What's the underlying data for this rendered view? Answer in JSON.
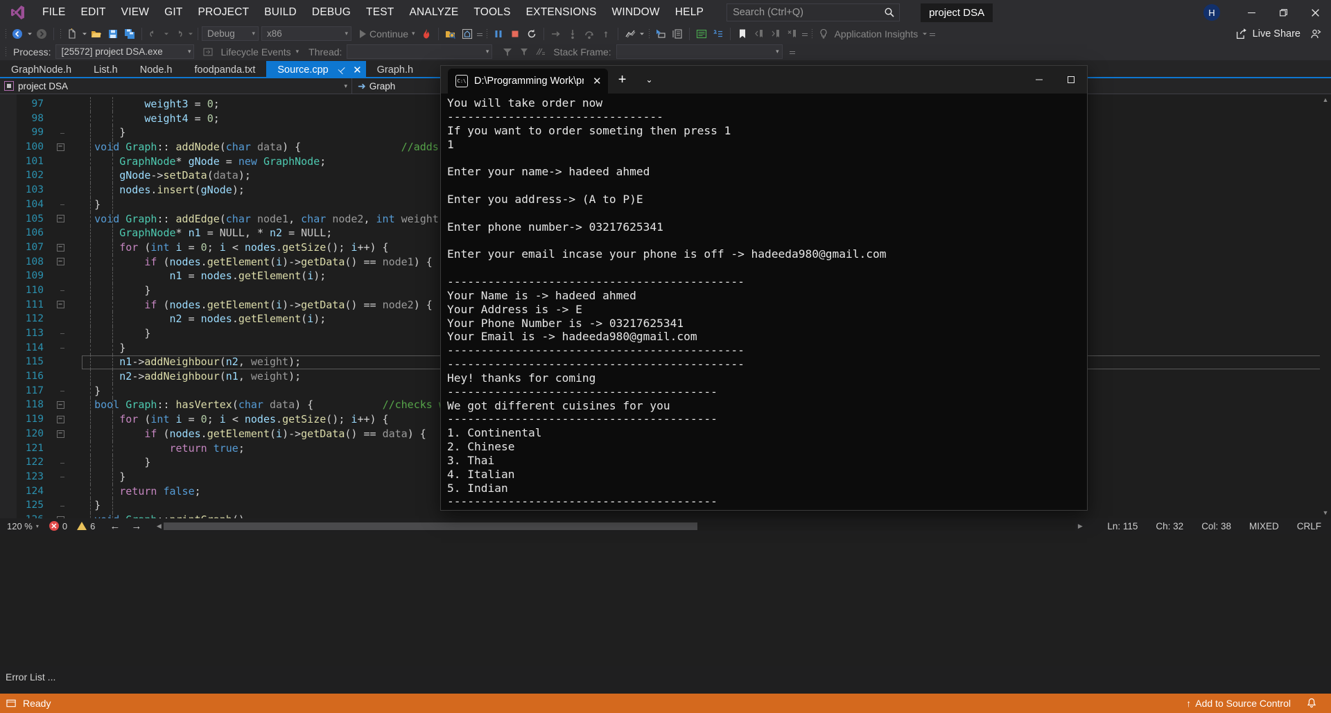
{
  "app": {
    "title_chip": "project DSA",
    "avatar_initial": "H",
    "live_share": "Live Share"
  },
  "menu": {
    "items": [
      "FILE",
      "EDIT",
      "VIEW",
      "GIT",
      "PROJECT",
      "BUILD",
      "DEBUG",
      "TEST",
      "ANALYZE",
      "TOOLS",
      "EXTENSIONS",
      "WINDOW",
      "HELP"
    ]
  },
  "search": {
    "placeholder": "Search (Ctrl+Q)",
    "value": ""
  },
  "toolbar": {
    "config": "Debug",
    "platform": "x86",
    "continue": "Continue",
    "app_insights": "Application Insights"
  },
  "debugbar": {
    "process_label": "Process:",
    "process_value": "[25572] project DSA.exe",
    "lifecycle": "Lifecycle Events",
    "thread_label": "Thread:",
    "thread_value": "",
    "stackframe_label": "Stack Frame:",
    "stackframe_value": ""
  },
  "tabs": [
    {
      "label": "GraphNode.h",
      "active": false
    },
    {
      "label": "List.h",
      "active": false
    },
    {
      "label": "Node.h",
      "active": false
    },
    {
      "label": "foodpanda.txt",
      "active": false
    },
    {
      "label": "Source.cpp",
      "active": true
    },
    {
      "label": "Graph.h",
      "active": false
    }
  ],
  "navbar": {
    "project": "project DSA",
    "scope": "Graph"
  },
  "editor": {
    "first_line": 97,
    "current_line": 115,
    "lines": [
      {
        "n": 97,
        "fold": "bar",
        "html": "            <span class='var'>weight3</span> <span class='pl'>=</span> <span class='num'>0</span><span class='pl'>;</span>"
      },
      {
        "n": 98,
        "fold": "bar",
        "html": "            <span class='var'>weight4</span> <span class='pl'>=</span> <span class='num'>0</span><span class='pl'>;</span>"
      },
      {
        "n": 99,
        "fold": "end",
        "html": "        <span class='pl'>}</span>"
      },
      {
        "n": 100,
        "fold": "minus",
        "html": "    <span class='kw'>void</span> <span class='typ'>Graph</span><span class='pl'>::</span> <span class='fn'>addNode</span><span class='pl'>(</span><span class='kw'>char</span> <span class='loc'>data</span><span class='pl'>) {</span>                <span class='cmt'>//adds n</span>"
      },
      {
        "n": 101,
        "fold": "bar",
        "html": "        <span class='typ'>GraphNode</span><span class='pl'>*</span> <span class='var'>gNode</span> <span class='pl'>=</span> <span class='kw'>new</span> <span class='typ'>GraphNode</span><span class='pl'>;</span>"
      },
      {
        "n": 102,
        "fold": "bar",
        "html": "        <span class='var'>gNode</span><span class='pl'>-&gt;</span><span class='fn'>setData</span><span class='pl'>(</span><span class='loc'>data</span><span class='pl'>);</span>"
      },
      {
        "n": 103,
        "fold": "bar",
        "html": "        <span class='var'>nodes</span><span class='pl'>.</span><span class='fn'>insert</span><span class='pl'>(</span><span class='var'>gNode</span><span class='pl'>);</span>"
      },
      {
        "n": 104,
        "fold": "end",
        "html": "    <span class='pl'>}</span>"
      },
      {
        "n": 105,
        "fold": "minus",
        "html": "    <span class='kw'>void</span> <span class='typ'>Graph</span><span class='pl'>::</span> <span class='fn'>addEdge</span><span class='pl'>(</span><span class='kw'>char</span> <span class='loc'>node1</span><span class='pl'>,</span> <span class='kw'>char</span> <span class='loc'>node2</span><span class='pl'>,</span> <span class='kw'>int</span> <span class='loc'>weight</span><span class='pl'>) {</span>"
      },
      {
        "n": 106,
        "fold": "bar",
        "html": "        <span class='typ'>GraphNode</span><span class='pl'>*</span> <span class='var'>n1</span> <span class='pl'>=</span> <span class='mac'>NULL</span><span class='pl'>,</span> <span class='pl'>*</span> <span class='var'>n2</span> <span class='pl'>=</span> <span class='mac'>NULL</span><span class='pl'>;</span>"
      },
      {
        "n": 107,
        "fold": "minus",
        "html": "        <span class='kwp'>for</span> <span class='pl'>(</span><span class='kw'>int</span> <span class='var'>i</span> <span class='pl'>=</span> <span class='num'>0</span><span class='pl'>;</span> <span class='var'>i</span> <span class='pl'>&lt;</span> <span class='var'>nodes</span><span class='pl'>.</span><span class='fn'>getSize</span><span class='pl'>();</span> <span class='var'>i</span><span class='pl'>++) {</span>"
      },
      {
        "n": 108,
        "fold": "minus2",
        "html": "            <span class='kwp'>if</span> <span class='pl'>(</span><span class='var'>nodes</span><span class='pl'>.</span><span class='fn'>getElement</span><span class='pl'>(</span><span class='var'>i</span><span class='pl'>)-&gt;</span><span class='fn'>getData</span><span class='pl'>()</span> <span class='pl'>==</span> <span class='loc'>node1</span><span class='pl'>) {</span>"
      },
      {
        "n": 109,
        "fold": "bar2",
        "html": "                <span class='var'>n1</span> <span class='pl'>=</span> <span class='var'>nodes</span><span class='pl'>.</span><span class='fn'>getElement</span><span class='pl'>(</span><span class='var'>i</span><span class='pl'>);</span>"
      },
      {
        "n": 110,
        "fold": "end2",
        "html": "            <span class='pl'>}</span>"
      },
      {
        "n": 111,
        "fold": "minus2",
        "html": "            <span class='kwp'>if</span> <span class='pl'>(</span><span class='var'>nodes</span><span class='pl'>.</span><span class='fn'>getElement</span><span class='pl'>(</span><span class='var'>i</span><span class='pl'>)-&gt;</span><span class='fn'>getData</span><span class='pl'>()</span> <span class='pl'>==</span> <span class='loc'>node2</span><span class='pl'>) {</span>"
      },
      {
        "n": 112,
        "fold": "bar2",
        "html": "                <span class='var'>n2</span> <span class='pl'>=</span> <span class='var'>nodes</span><span class='pl'>.</span><span class='fn'>getElement</span><span class='pl'>(</span><span class='var'>i</span><span class='pl'>);</span>"
      },
      {
        "n": 113,
        "fold": "end2",
        "html": "            <span class='pl'>}</span>"
      },
      {
        "n": 114,
        "fold": "end",
        "html": "        <span class='pl'>}</span>"
      },
      {
        "n": 115,
        "fold": "bar",
        "html": "        <span class='var'>n1</span><span class='pl'>-&gt;</span><span class='fn'>addNeighbour</span><span class='pl'>(</span><span class='var'>n2</span><span class='pl'>,</span> <span class='loc'>weight</span><span class='pl'>);</span>"
      },
      {
        "n": 116,
        "fold": "bar",
        "html": "        <span class='var'>n2</span><span class='pl'>-&gt;</span><span class='fn'>addNeighbour</span><span class='pl'>(</span><span class='var'>n1</span><span class='pl'>,</span> <span class='loc'>weight</span><span class='pl'>);</span>"
      },
      {
        "n": 117,
        "fold": "end",
        "html": "    <span class='pl'>}</span>"
      },
      {
        "n": 118,
        "fold": "minus",
        "html": "    <span class='kw'>bool</span> <span class='typ'>Graph</span><span class='pl'>::</span> <span class='fn'>hasVertex</span><span class='pl'>(</span><span class='kw'>char</span> <span class='loc'>data</span><span class='pl'>) {</span>           <span class='cmt'>//checks wh</span>"
      },
      {
        "n": 119,
        "fold": "minus",
        "html": "        <span class='kwp'>for</span> <span class='pl'>(</span><span class='kw'>int</span> <span class='var'>i</span> <span class='pl'>=</span> <span class='num'>0</span><span class='pl'>;</span> <span class='var'>i</span> <span class='pl'>&lt;</span> <span class='var'>nodes</span><span class='pl'>.</span><span class='fn'>getSize</span><span class='pl'>();</span> <span class='var'>i</span><span class='pl'>++) {</span>"
      },
      {
        "n": 120,
        "fold": "minus2",
        "html": "            <span class='kwp'>if</span> <span class='pl'>(</span><span class='var'>nodes</span><span class='pl'>.</span><span class='fn'>getElement</span><span class='pl'>(</span><span class='var'>i</span><span class='pl'>)-&gt;</span><span class='fn'>getData</span><span class='pl'>()</span> <span class='pl'>==</span> <span class='loc'>data</span><span class='pl'>) {</span>"
      },
      {
        "n": 121,
        "fold": "bar2",
        "html": "                <span class='kwp'>return</span> <span class='kw'>true</span><span class='pl'>;</span>"
      },
      {
        "n": 122,
        "fold": "end2",
        "html": "            <span class='pl'>}</span>"
      },
      {
        "n": 123,
        "fold": "end",
        "html": "        <span class='pl'>}</span>"
      },
      {
        "n": 124,
        "fold": "bar",
        "html": "        <span class='kwp'>return</span> <span class='kw'>false</span><span class='pl'>;</span>"
      },
      {
        "n": 125,
        "fold": "end",
        "html": "    <span class='pl'>}</span>"
      },
      {
        "n": 126,
        "fold": "minus",
        "html": "    <span class='kw'>void</span> <span class='typ'>Graph</span><span class='pl'>::</span><span class='fn'>printGraph</span><span class='pl'>()</span>"
      }
    ]
  },
  "editbar": {
    "zoom": "120 %",
    "error_count": "0",
    "warning_count": "6"
  },
  "infobar": {
    "ln": "Ln: 115",
    "ch": "Ch: 32",
    "col": "Col: 38",
    "mixed": "MIXED",
    "eol": "CRLF"
  },
  "errorlist": {
    "label": "Error List ..."
  },
  "statusbar": {
    "ready": "Ready",
    "source_control": "Add to Source Control"
  },
  "terminal": {
    "tab_title": "D:\\Programming Work\\projec",
    "lines": [
      "You will take order now",
      "--------------------------------",
      "If you want to order someting then press 1",
      "1",
      "",
      "Enter your name-> hadeed ahmed",
      "",
      "Enter you address-> (A to P)E",
      "",
      "Enter phone number-> 03217625341",
      "",
      "Enter your email incase your phone is off -> hadeeda980@gmail.com",
      "",
      "--------------------------------------------",
      "Your Name is -> hadeed ahmed",
      "Your Address is -> E",
      "Your Phone Number is -> 03217625341",
      "Your Email is -> hadeeda980@gmail.com",
      "--------------------------------------------",
      "--------------------------------------------",
      "Hey! thanks for coming",
      "----------------------------------------",
      "We got different cuisines for you",
      "----------------------------------------",
      "1. Continental",
      "2. Chinese",
      "3. Thai",
      "4. Italian",
      "5. Indian",
      "----------------------------------------"
    ]
  },
  "colors": {
    "accent": "#0e77d1",
    "status": "#d4691e",
    "terminal_bg": "#0c0c0c"
  }
}
